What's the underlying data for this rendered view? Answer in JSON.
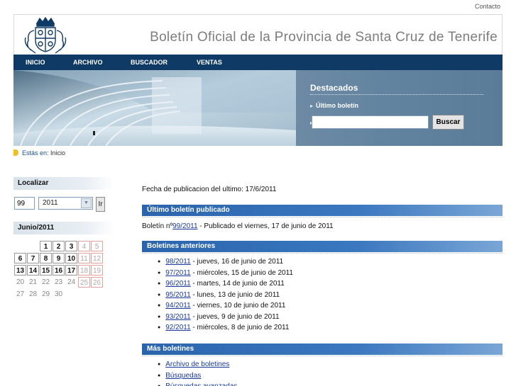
{
  "contact": "Contacto",
  "site_title": "Boletín Oficial de la Provincia de Santa Cruz de Tenerife",
  "nav": [
    {
      "label": "INICIO"
    },
    {
      "label": "ARCHIVO"
    },
    {
      "label": "BUSCADOR"
    },
    {
      "label": "VENTAS"
    }
  ],
  "destacados": {
    "title": "Destacados",
    "link": "Último boletín",
    "input_value": "",
    "button": "Buscar"
  },
  "breadcrumb": {
    "label": "Estás en:",
    "current": "Inicio"
  },
  "localizar": {
    "title": "Localizar",
    "number_value": "99",
    "year_value": "2011",
    "go_button": "Ir"
  },
  "calendar": {
    "title": "Junio/2011",
    "rows": [
      [
        {
          "d": "",
          "t": "plain"
        },
        {
          "d": "",
          "t": "plain"
        },
        {
          "d": "1",
          "t": "boxed"
        },
        {
          "d": "2",
          "t": "boxed"
        },
        {
          "d": "3",
          "t": "boxed"
        },
        {
          "d": "4",
          "t": "weekend"
        },
        {
          "d": "5",
          "t": "weekend"
        }
      ],
      [
        {
          "d": "6",
          "t": "boxed"
        },
        {
          "d": "7",
          "t": "boxed"
        },
        {
          "d": "8",
          "t": "boxed"
        },
        {
          "d": "9",
          "t": "boxed"
        },
        {
          "d": "10",
          "t": "boxed"
        },
        {
          "d": "11",
          "t": "weekend"
        },
        {
          "d": "12",
          "t": "weekend"
        }
      ],
      [
        {
          "d": "13",
          "t": "boxed"
        },
        {
          "d": "14",
          "t": "boxed"
        },
        {
          "d": "15",
          "t": "boxed"
        },
        {
          "d": "16",
          "t": "boxed"
        },
        {
          "d": "17",
          "t": "boxed"
        },
        {
          "d": "18",
          "t": "weekend"
        },
        {
          "d": "19",
          "t": "weekend"
        }
      ],
      [
        {
          "d": "20",
          "t": "plain"
        },
        {
          "d": "21",
          "t": "plain"
        },
        {
          "d": "22",
          "t": "plain"
        },
        {
          "d": "23",
          "t": "plain"
        },
        {
          "d": "24",
          "t": "plain"
        },
        {
          "d": "25",
          "t": "weekend"
        },
        {
          "d": "26",
          "t": "weekend"
        }
      ],
      [
        {
          "d": "27",
          "t": "plain"
        },
        {
          "d": "28",
          "t": "plain"
        },
        {
          "d": "29",
          "t": "plain"
        },
        {
          "d": "30",
          "t": "plain"
        }
      ]
    ]
  },
  "main": {
    "pub_date": "Fecha de publicacion del ultimo: 17/6/2011",
    "latest_title": "Último boletín publicado",
    "latest": {
      "prefix": "Boletín nº",
      "link": "99/2011",
      "suffix": " - Publicado el viernes, 17 de junio de 2011"
    },
    "previous_title": "Boletines anteriores",
    "previous": [
      {
        "link": "98/2011",
        "text": " - jueves, 16 de junio de 2011"
      },
      {
        "link": "97/2011",
        "text": " - miércoles, 15 de junio de 2011"
      },
      {
        "link": "96/2011",
        "text": " - martes, 14 de junio de 2011"
      },
      {
        "link": "95/2011",
        "text": " - lunes, 13 de junio de 2011"
      },
      {
        "link": "94/2011",
        "text": " - viernes, 10 de junio de 2011"
      },
      {
        "link": "93/2011",
        "text": " - jueves, 9 de junio de 2011"
      },
      {
        "link": "92/2011",
        "text": " - miércoles, 8 de junio de 2011"
      }
    ],
    "more_title": "Más boletines",
    "more": [
      {
        "link": "Archivo de boletines"
      },
      {
        "link": "Búsquedas"
      },
      {
        "link": "Búsquedas avanzadas"
      }
    ]
  }
}
